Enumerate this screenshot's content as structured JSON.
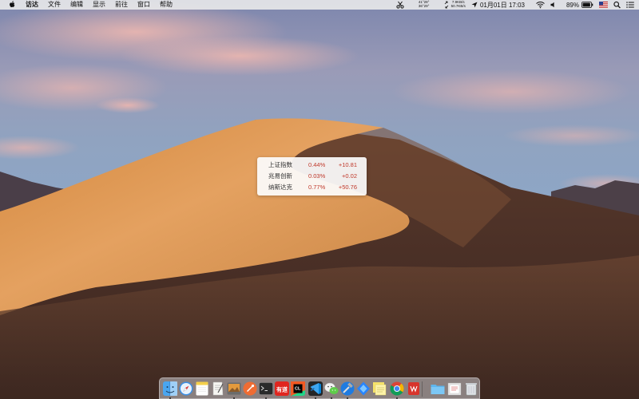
{
  "menubar": {
    "apple_icon": "apple-logo-icon",
    "menus": [
      "访达",
      "文件",
      "编辑",
      "显示",
      "前往",
      "窗口",
      "帮助"
    ],
    "status": {
      "tools_icon": "scissors-icon",
      "cpu_temp": "41°",
      "cpu_load": "28°",
      "gpu_temp": "36°",
      "gpu_load": "29°",
      "net_up": "7.9KB/s",
      "net_down": "50.7KB/s",
      "location_icon": "location-arrow-icon",
      "clock": "01月01日 17:03",
      "wifi_icon": "wifi-icon",
      "volume_icon": "speaker-icon",
      "battery_pct": "89%",
      "battery_level": 0.89,
      "input_source_icon": "us-flag-icon",
      "search_icon": "spotlight-search-icon",
      "notification_icon": "notification-center-icon"
    }
  },
  "stock_widget": {
    "rows": [
      {
        "name": "上证指数",
        "pct": "0.44%",
        "change": "+10.81"
      },
      {
        "name": "兆易创新",
        "pct": "0.03%",
        "change": "+0.02"
      },
      {
        "name": "纳斯达克",
        "pct": "0.77%",
        "change": "+50.76"
      }
    ],
    "up_color": "#c0392b"
  },
  "dock": {
    "apps": [
      {
        "name": "finder",
        "icon": "finder-icon",
        "running": true
      },
      {
        "name": "safari",
        "icon": "compass-icon",
        "running": false
      },
      {
        "name": "notes",
        "icon": "notes-icon",
        "running": false
      },
      {
        "name": "textedit",
        "icon": "document-pen-icon",
        "running": false
      },
      {
        "name": "preview",
        "icon": "preview-icon",
        "running": true
      },
      {
        "name": "postman",
        "icon": "postman-icon",
        "running": false
      },
      {
        "name": "terminal",
        "icon": "terminal-icon",
        "running": true
      },
      {
        "name": "youdao",
        "icon": "youdao-icon",
        "label": "有道",
        "running": false
      },
      {
        "name": "clion",
        "icon": "clion-icon",
        "label": "CL",
        "running": false
      },
      {
        "name": "vscode",
        "icon": "vscode-icon",
        "running": true
      },
      {
        "name": "wechat",
        "icon": "wechat-icon",
        "running": true
      },
      {
        "name": "xcode",
        "icon": "hammer-icon",
        "running": true
      },
      {
        "name": "sourcetree",
        "icon": "sourcetree-icon",
        "running": false
      },
      {
        "name": "stickies",
        "icon": "sticky-note-icon",
        "running": false
      },
      {
        "name": "chrome",
        "icon": "chrome-icon",
        "running": true
      },
      {
        "name": "wps",
        "icon": "wps-icon",
        "running": false
      },
      {
        "name": "downloads",
        "icon": "folder-icon",
        "running": false
      },
      {
        "name": "documents",
        "icon": "document-stack-icon",
        "running": false
      },
      {
        "name": "trash",
        "icon": "trash-icon",
        "running": false
      }
    ]
  }
}
